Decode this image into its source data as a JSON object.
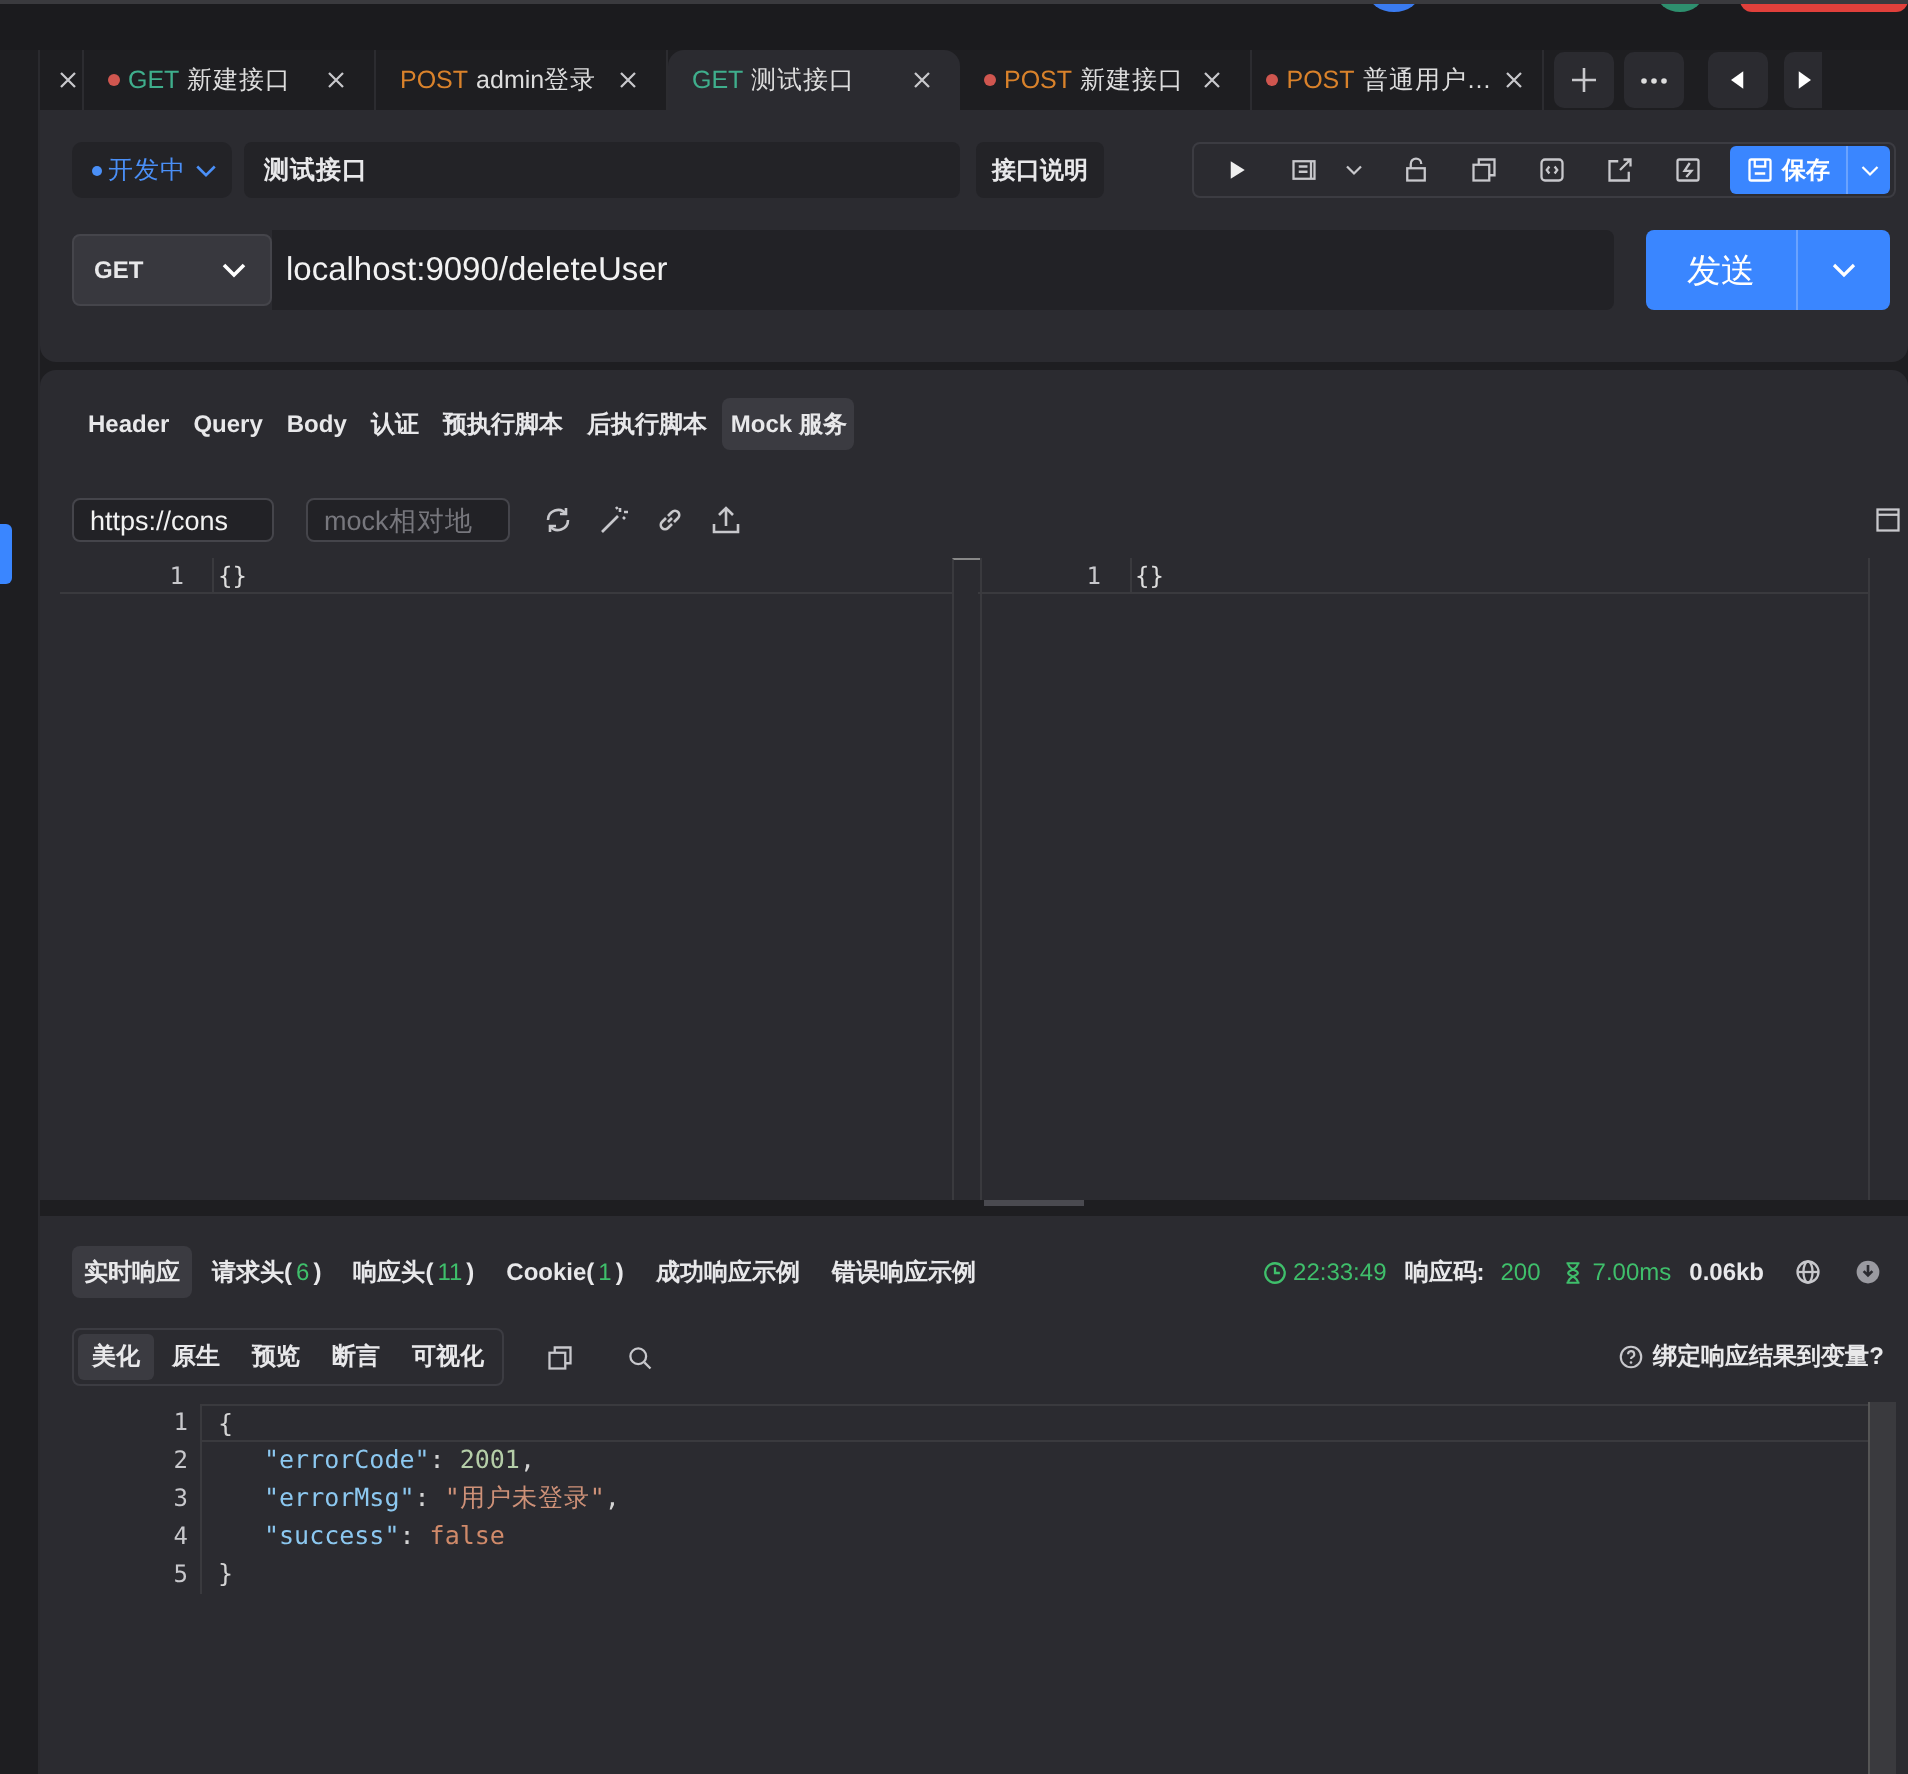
{
  "tabs": [
    {
      "method": "GET",
      "name": "新建接口",
      "color": "#3fae8c",
      "unsaved": true,
      "selected": false
    },
    {
      "method": "POST",
      "name": "admin登录",
      "color": "#d9822b",
      "unsaved": false,
      "selected": false
    },
    {
      "method": "GET",
      "name": "测试接口",
      "color": "#3fae8c",
      "unsaved": false,
      "selected": true
    },
    {
      "method": "POST",
      "name": "新建接口",
      "color": "#d9822b",
      "unsaved": true,
      "selected": false
    },
    {
      "method": "POST",
      "name": "普通用户…",
      "color": "#d9822b",
      "unsaved": true,
      "selected": false
    }
  ],
  "status": {
    "label": "开发中"
  },
  "api_name": "测试接口",
  "doc_button": "接口说明",
  "save_button": "保存",
  "method": "GET",
  "url": "localhost:9090/deleteUser",
  "send_button": "发送",
  "request_tabs": [
    {
      "label": "Header",
      "selected": false
    },
    {
      "label": "Query",
      "selected": false
    },
    {
      "label": "Body",
      "selected": false
    },
    {
      "label": "认证",
      "selected": false
    },
    {
      "label": "预执行脚本",
      "selected": false
    },
    {
      "label": "后执行脚本",
      "selected": false
    },
    {
      "label": "Mock 服务",
      "selected": true
    }
  ],
  "mock": {
    "url_value": "https://cons",
    "path_placeholder": "mock相对地"
  },
  "editors": [
    {
      "line": "1",
      "text": "{}"
    },
    {
      "line": "1",
      "text": "{}"
    }
  ],
  "response_tabs": [
    {
      "label": "实时响应",
      "selected": true
    },
    {
      "label": "请求头(",
      "count": "6",
      "close": ")",
      "selected": false
    },
    {
      "label": "响应头(",
      "count": "11",
      "close": ")",
      "selected": false
    },
    {
      "label": "Cookie(",
      "count": "1",
      "close": ")",
      "selected": false
    },
    {
      "label": "成功响应示例",
      "selected": false
    },
    {
      "label": "错误响应示例",
      "selected": false
    }
  ],
  "response_meta": {
    "time": "22:33:49",
    "code_label": "响应码:",
    "code": "200",
    "duration": "7.00ms",
    "size": "0.06kb"
  },
  "view_tabs": [
    {
      "label": "美化",
      "selected": true
    },
    {
      "label": "原生",
      "selected": false
    },
    {
      "label": "预览",
      "selected": false
    },
    {
      "label": "断言",
      "selected": false
    },
    {
      "label": "可视化",
      "selected": false
    }
  ],
  "bind_link": "绑定响应结果到变量?",
  "response_body": [
    {
      "line": "1",
      "indent": false,
      "tokens": [
        {
          "kind": "punct",
          "text": "{"
        }
      ]
    },
    {
      "line": "2",
      "indent": true,
      "tokens": [
        {
          "kind": "key",
          "text": "\"errorCode\""
        },
        {
          "kind": "punct",
          "text": ": "
        },
        {
          "kind": "number",
          "text": "2001"
        },
        {
          "kind": "punct",
          "text": ","
        }
      ]
    },
    {
      "line": "3",
      "indent": true,
      "tokens": [
        {
          "kind": "key",
          "text": "\"errorMsg\""
        },
        {
          "kind": "punct",
          "text": ": "
        },
        {
          "kind": "string",
          "text": "\"用户未登录\""
        },
        {
          "kind": "punct",
          "text": ","
        }
      ]
    },
    {
      "line": "4",
      "indent": true,
      "tokens": [
        {
          "kind": "key",
          "text": "\"success\""
        },
        {
          "kind": "punct",
          "text": ": "
        },
        {
          "kind": "bool",
          "text": "false"
        }
      ]
    },
    {
      "line": "5",
      "indent": false,
      "tokens": [
        {
          "kind": "punct",
          "text": "}"
        }
      ]
    }
  ]
}
